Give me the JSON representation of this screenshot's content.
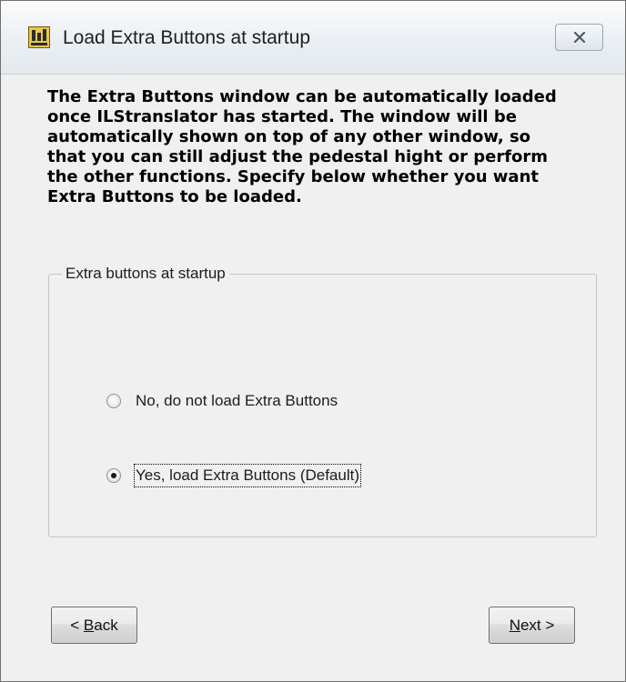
{
  "window": {
    "title": "Load Extra Buttons at startup"
  },
  "description": "The Extra Buttons window can be automatically loaded\nonce ILStranslator has started. The window will be\nautomatically shown on top of any other window, so\nthat you can still adjust the pedestal hight or perform\nthe other functions. Specify below whether you want\nExtra Buttons to be loaded.",
  "group": {
    "label": "Extra buttons at startup",
    "options": [
      {
        "label": "No, do not load Extra Buttons",
        "selected": false
      },
      {
        "label": "Yes, load Extra Buttons  (Default)",
        "selected": true
      }
    ]
  },
  "buttons": {
    "back": {
      "accel": "B",
      "rest": "ack",
      "prefix": "< "
    },
    "next": {
      "accel": "N",
      "rest": "ext >"
    }
  },
  "icons": {
    "app": "app-icon",
    "close": "close-icon"
  }
}
